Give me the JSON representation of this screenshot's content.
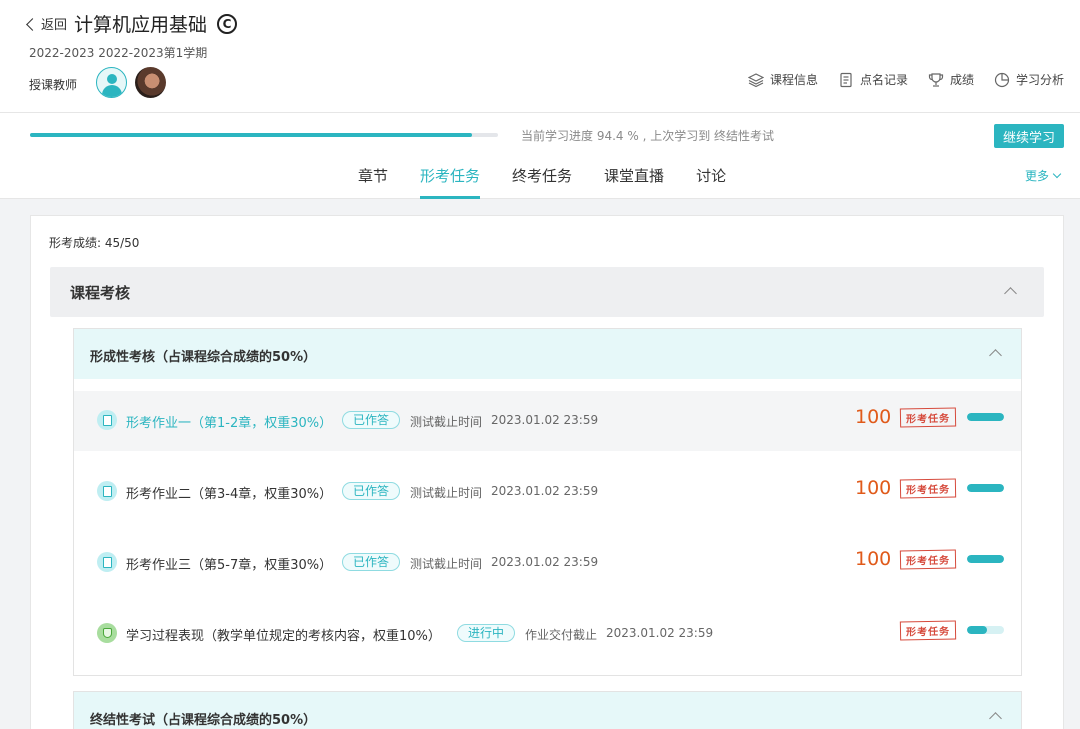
{
  "header": {
    "back_label": "返回",
    "course_title": "计算机应用基础",
    "term": "2022-2023 2022-2023第1学期",
    "teacher_label": "授课教师",
    "links": [
      {
        "label": "课程信息",
        "icon": "layers-icon"
      },
      {
        "label": "点名记录",
        "icon": "document-icon"
      },
      {
        "label": "成绩",
        "icon": "trophy-icon"
      },
      {
        "label": "学习分析",
        "icon": "pie-chart-icon"
      }
    ]
  },
  "progress": {
    "percent": 94.4,
    "text": "当前学习进度 94.4 % , 上次学习到 终结性考试",
    "continue_label": "继续学习"
  },
  "tabs": [
    {
      "label": "章节",
      "active": false
    },
    {
      "label": "形考任务",
      "active": true
    },
    {
      "label": "终考任务",
      "active": false
    },
    {
      "label": "课堂直播",
      "active": false
    },
    {
      "label": "讨论",
      "active": false
    }
  ],
  "more_label": "更多",
  "content": {
    "score": "形考成绩: 45/50",
    "section_title": "课程考核",
    "formative": {
      "title": "形成性考核（占课程综合成绩的50%）",
      "items": [
        {
          "title": "形考作业一（第1-2章，权重30%）",
          "status": "已作答",
          "deadline_label": "测试截止时间",
          "deadline": "2023.01.02 23:59",
          "points": "100",
          "stamp": "形考任务",
          "progress": 1.0,
          "icon": "assignment-icon"
        },
        {
          "title": "形考作业二（第3-4章，权重30%）",
          "status": "已作答",
          "deadline_label": "测试截止时间",
          "deadline": "2023.01.02 23:59",
          "points": "100",
          "stamp": "形考任务",
          "progress": 1.0,
          "icon": "assignment-icon"
        },
        {
          "title": "形考作业三（第5-7章，权重30%）",
          "status": "已作答",
          "deadline_label": "测试截止时间",
          "deadline": "2023.01.02 23:59",
          "points": "100",
          "stamp": "形考任务",
          "progress": 1.0,
          "icon": "assignment-icon"
        },
        {
          "title": "学习过程表现（教学单位规定的考核内容，权重10%）",
          "status": "进行中",
          "deadline_label": "作业交付截止",
          "deadline": "2023.01.02 23:59",
          "points": "",
          "stamp": "形考任务",
          "progress": 0.55,
          "icon": "medal-icon"
        }
      ]
    },
    "summative": {
      "title": "终结性考试（占课程综合成绩的50%）"
    }
  },
  "colors": {
    "accent": "#2bb5c0",
    "points": "#e05a1a",
    "stamp": "#d64a3c"
  }
}
